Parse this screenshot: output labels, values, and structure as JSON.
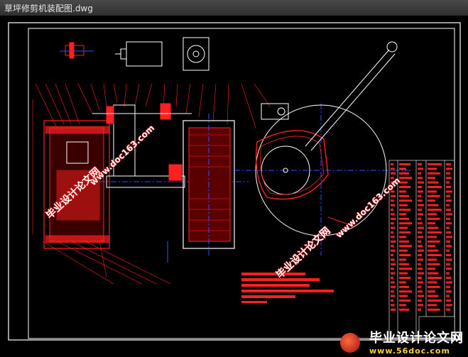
{
  "window": {
    "title": "草坪修剪机装配图.dwg"
  },
  "watermarks": {
    "site_cn": "毕业设计论文网",
    "site_url": "www.doc163.com"
  },
  "footer_brand": {
    "name": "毕业设计论文网",
    "url": "www.56doc.com"
  },
  "colors": {
    "background": "#000000",
    "drawing_red": "#ff2020",
    "drawing_white": "#ffffff",
    "drawing_blue": "#3050ff",
    "titlebar": "#3a3a3a"
  },
  "icons": {
    "brand_logo": "brand-logo-icon"
  }
}
